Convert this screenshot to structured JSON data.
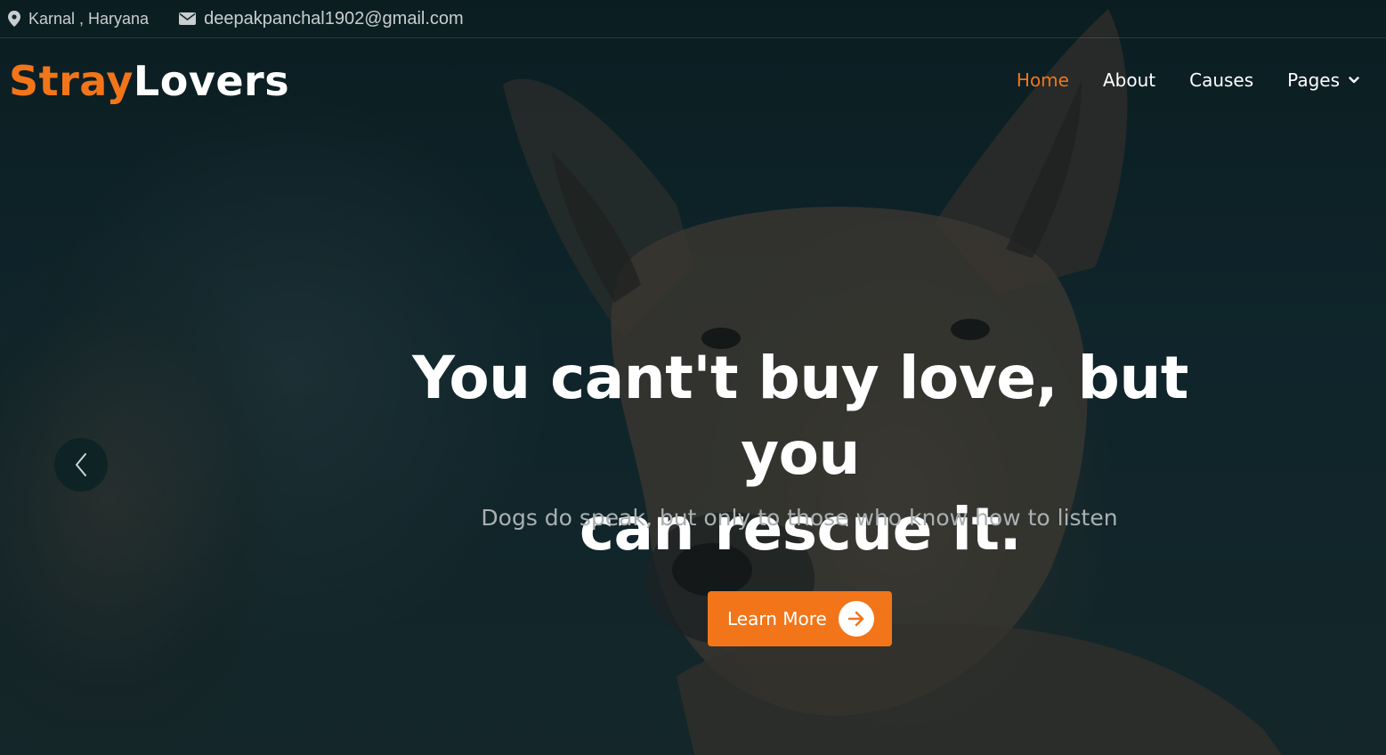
{
  "topbar": {
    "location_icon": "map-pin-icon",
    "location": "Karnal , Haryana",
    "email_icon": "envelope-icon",
    "email": "deepakpanchal1902@gmail.com"
  },
  "brand": {
    "part1": "Stray",
    "part2": "Lovers"
  },
  "nav": {
    "items": [
      {
        "label": "Home",
        "active": true
      },
      {
        "label": "About"
      },
      {
        "label": "Causes"
      },
      {
        "label": "Pages",
        "has_dropdown": true
      }
    ],
    "dropdown_icon": "chevron-down-icon"
  },
  "hero": {
    "headline_line1": "You cant't buy love, but you",
    "headline_line2": "can rescue it.",
    "subtitle": "Dogs do speak, but only to those who know how to listen",
    "cta_label": "Learn More",
    "cta_icon": "arrow-right-icon",
    "prev_icon": "chevron-left-icon",
    "image": "dog-photo"
  },
  "colors": {
    "accent": "#f2751a",
    "text_light": "#ffffff",
    "text_muted": "#a9b0b2",
    "background_dark": "#13272b"
  }
}
